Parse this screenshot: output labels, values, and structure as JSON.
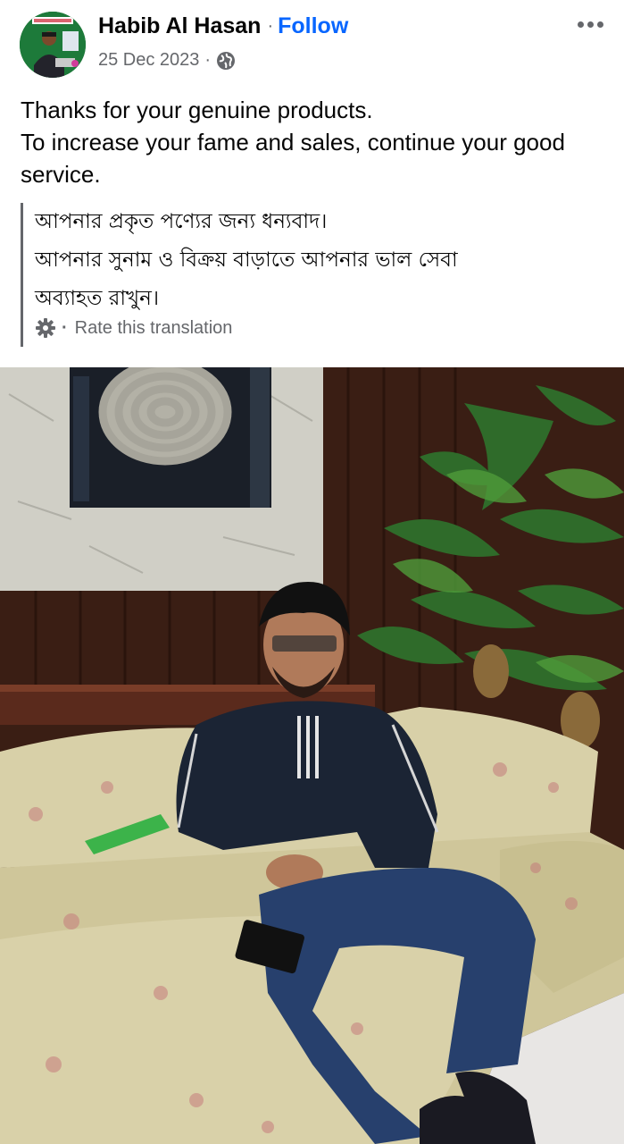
{
  "post": {
    "author": "Habib Al Hasan",
    "separator": "·",
    "follow_label": "Follow",
    "date": "25 Dec 2023",
    "date_separator": "·",
    "audience_icon": "globe-icon",
    "more_icon": "more-options-icon",
    "text_lines": [
      "Thanks for your genuine products.",
      "To increase your fame and sales, continue your good service."
    ],
    "translation": {
      "lines": [
        "আপনার প্রকৃত পণ্যের জন্য ধন্যবাদ।",
        "আপনার সুনাম ও বিক্রয় বাড়াতে আপনার ভাল সেবা",
        "অব্যাহত রাখুন।"
      ],
      "settings_icon": "gear-icon",
      "rate_label": "Rate this translation"
    },
    "photo_icon": "photo-man-on-sofa"
  },
  "colors": {
    "accent": "#0866ff",
    "secondary_text": "#65676b",
    "primary_text": "#050505"
  }
}
